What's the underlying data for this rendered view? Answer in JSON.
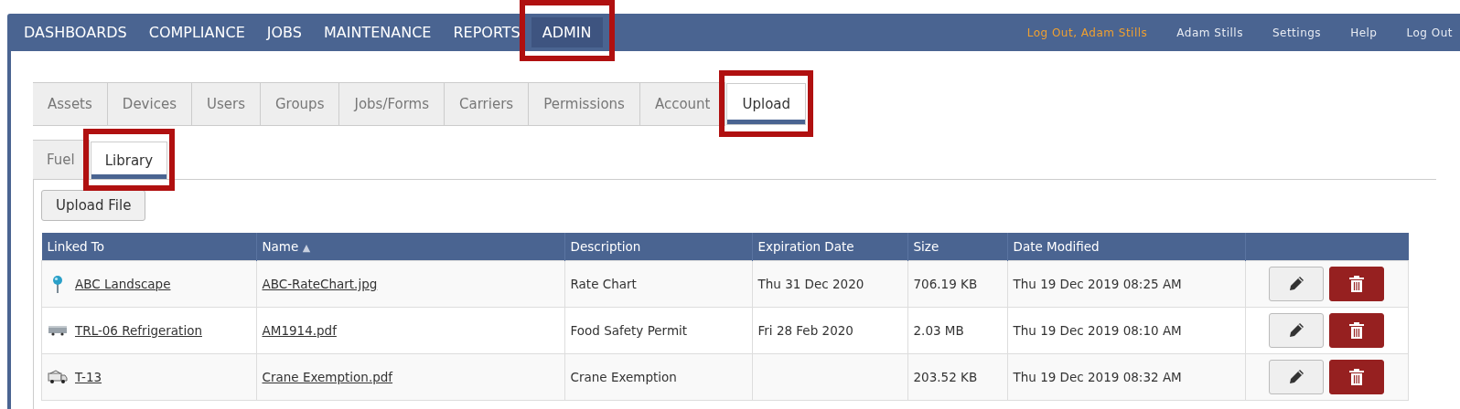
{
  "nav": {
    "items": [
      {
        "label": "DASHBOARDS",
        "selected": false,
        "highlighted": false
      },
      {
        "label": "COMPLIANCE",
        "selected": false,
        "highlighted": false
      },
      {
        "label": "JOBS",
        "selected": false,
        "highlighted": false
      },
      {
        "label": "MAINTENANCE",
        "selected": false,
        "highlighted": false
      },
      {
        "label": "REPORTS",
        "selected": false,
        "highlighted": false
      },
      {
        "label": "ADMIN",
        "selected": true,
        "highlighted": true
      }
    ],
    "user_links": [
      {
        "label": "Log Out, Adam Stills",
        "kind": "accent"
      },
      {
        "label": "Adam Stills",
        "kind": "plain"
      },
      {
        "label": "Settings",
        "kind": "plain"
      },
      {
        "label": "Help",
        "kind": "plain"
      },
      {
        "label": "Log Out",
        "kind": "plain"
      }
    ]
  },
  "tabs": [
    {
      "label": "Assets",
      "selected": false,
      "highlighted": false
    },
    {
      "label": "Devices",
      "selected": false,
      "highlighted": false
    },
    {
      "label": "Users",
      "selected": false,
      "highlighted": false
    },
    {
      "label": "Groups",
      "selected": false,
      "highlighted": false
    },
    {
      "label": "Jobs/Forms",
      "selected": false,
      "highlighted": false
    },
    {
      "label": "Carriers",
      "selected": false,
      "highlighted": false
    },
    {
      "label": "Permissions",
      "selected": false,
      "highlighted": false
    },
    {
      "label": "Account",
      "selected": false,
      "highlighted": false
    },
    {
      "label": "Upload",
      "selected": true,
      "highlighted": true
    }
  ],
  "subtabs": [
    {
      "label": "Fuel",
      "selected": false,
      "highlighted": false
    },
    {
      "label": "Library",
      "selected": true,
      "highlighted": true
    }
  ],
  "upload_button": "Upload File",
  "table": {
    "columns": [
      {
        "label": "Linked To"
      },
      {
        "label": "Name",
        "sort_mark": "▲"
      },
      {
        "label": "Description"
      },
      {
        "label": "Expiration Date"
      },
      {
        "label": "Size"
      },
      {
        "label": "Date Modified"
      }
    ],
    "rows": [
      {
        "kind": "location",
        "linked_to": "ABC Landscape",
        "name": "ABC-RateChart.jpg",
        "description": "Rate Chart",
        "expiration": "Thu 31 Dec 2020",
        "size": "706.19 KB",
        "modified": "Thu 19 Dec 2019 08:25 AM"
      },
      {
        "kind": "trailer",
        "linked_to": "TRL-06 Refrigeration",
        "name": "AM1914.pdf",
        "description": "Food Safety Permit",
        "expiration": "Fri 28 Feb 2020",
        "size": "2.03 MB",
        "modified": "Thu 19 Dec 2019 08:10 AM"
      },
      {
        "kind": "truck",
        "linked_to": "T-13",
        "name": "Crane Exemption.pdf",
        "description": "Crane Exemption",
        "expiration": "",
        "size": "203.52 KB",
        "modified": "Thu 19 Dec 2019 08:32 AM"
      }
    ]
  }
}
